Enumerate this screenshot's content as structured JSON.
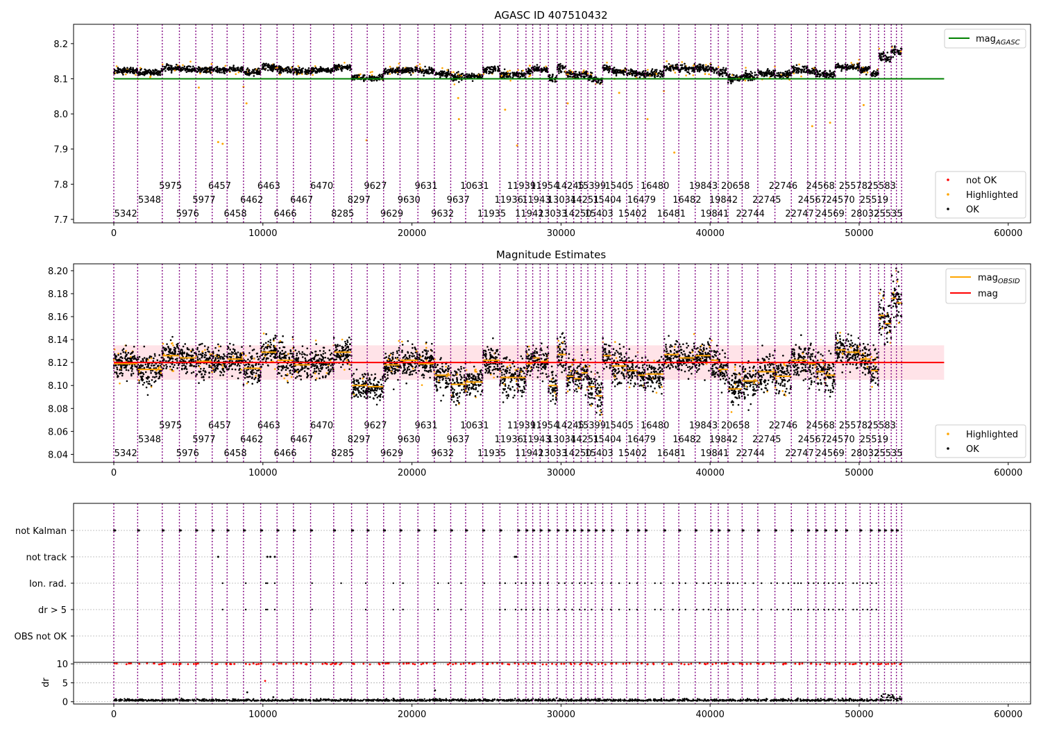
{
  "colors": {
    "ok": "#000000",
    "highlighted": "#ffa500",
    "not_ok": "#ff0000",
    "mag_agasc_line": "#008000",
    "mag_line": "#ff0000",
    "mag_band": "#ffc0cb",
    "obs_line": "#800080"
  },
  "obs_boundaries": [
    0,
    1600,
    3250,
    4400,
    5500,
    6600,
    7600,
    8700,
    9850,
    10950,
    12050,
    13200,
    14750,
    15950,
    17000,
    18100,
    19200,
    20400,
    21500,
    22600,
    23600,
    24750,
    25900,
    27100,
    27650,
    28100,
    28600,
    29150,
    29750,
    30350,
    30850,
    31350,
    31800,
    32300,
    32800,
    33400,
    34400,
    35150,
    35650,
    36900,
    37900,
    39000,
    40050,
    40550,
    41200,
    42150,
    43200,
    44350,
    45450,
    46550,
    47100,
    47700,
    48400,
    49100,
    50050,
    50750,
    51300,
    51700,
    52150,
    52500,
    52850
  ],
  "obs_labels": [
    {
      "x": 800,
      "row": 0,
      "text": "5342"
    },
    {
      "x": 2400,
      "row": 1,
      "text": "5348"
    },
    {
      "x": 3800,
      "row": 2,
      "text": "5975"
    },
    {
      "x": 4950,
      "row": 0,
      "text": "5976"
    },
    {
      "x": 6050,
      "row": 1,
      "text": "5977"
    },
    {
      "x": 7100,
      "row": 2,
      "text": "6457"
    },
    {
      "x": 8150,
      "row": 0,
      "text": "6458"
    },
    {
      "x": 9250,
      "row": 1,
      "text": "6462"
    },
    {
      "x": 10400,
      "row": 2,
      "text": "6463"
    },
    {
      "x": 11500,
      "row": 0,
      "text": "6466"
    },
    {
      "x": 12600,
      "row": 1,
      "text": "6467"
    },
    {
      "x": 13950,
      "row": 2,
      "text": "6470"
    },
    {
      "x": 15350,
      "row": 0,
      "text": "8285"
    },
    {
      "x": 16450,
      "row": 1,
      "text": "8297"
    },
    {
      "x": 17550,
      "row": 2,
      "text": "9627"
    },
    {
      "x": 18650,
      "row": 0,
      "text": "9629"
    },
    {
      "x": 19800,
      "row": 1,
      "text": "9630"
    },
    {
      "x": 20950,
      "row": 2,
      "text": "9631"
    },
    {
      "x": 22050,
      "row": 0,
      "text": "9632"
    },
    {
      "x": 23100,
      "row": 1,
      "text": "9637"
    },
    {
      "x": 24200,
      "row": 2,
      "text": "10631"
    },
    {
      "x": 25350,
      "row": 0,
      "text": "11935"
    },
    {
      "x": 26500,
      "row": 1,
      "text": "11936"
    },
    {
      "x": 27350,
      "row": 2,
      "text": "11939"
    },
    {
      "x": 27880,
      "row": 0,
      "text": "11942"
    },
    {
      "x": 28350,
      "row": 1,
      "text": "11943"
    },
    {
      "x": 28900,
      "row": 2,
      "text": "11954"
    },
    {
      "x": 29450,
      "row": 0,
      "text": "13033"
    },
    {
      "x": 30050,
      "row": 1,
      "text": "13034"
    },
    {
      "x": 30600,
      "row": 2,
      "text": "14245"
    },
    {
      "x": 31100,
      "row": 0,
      "text": "14250"
    },
    {
      "x": 31600,
      "row": 1,
      "text": "14251"
    },
    {
      "x": 32050,
      "row": 2,
      "text": "15399"
    },
    {
      "x": 32550,
      "row": 0,
      "text": "15403"
    },
    {
      "x": 33100,
      "row": 1,
      "text": "15404"
    },
    {
      "x": 33900,
      "row": 2,
      "text": "15405"
    },
    {
      "x": 34800,
      "row": 0,
      "text": "15402"
    },
    {
      "x": 35400,
      "row": 1,
      "text": "16479"
    },
    {
      "x": 36300,
      "row": 2,
      "text": "16480"
    },
    {
      "x": 37400,
      "row": 0,
      "text": "16481"
    },
    {
      "x": 38450,
      "row": 1,
      "text": "16482"
    },
    {
      "x": 39550,
      "row": 2,
      "text": "19843"
    },
    {
      "x": 40300,
      "row": 0,
      "text": "19841"
    },
    {
      "x": 40900,
      "row": 1,
      "text": "19842"
    },
    {
      "x": 41700,
      "row": 2,
      "text": "20658"
    },
    {
      "x": 42700,
      "row": 0,
      "text": "22744"
    },
    {
      "x": 43800,
      "row": 1,
      "text": "22745"
    },
    {
      "x": 44900,
      "row": 2,
      "text": "22746"
    },
    {
      "x": 46000,
      "row": 0,
      "text": "22747"
    },
    {
      "x": 46850,
      "row": 1,
      "text": "24567"
    },
    {
      "x": 47400,
      "row": 2,
      "text": "24568"
    },
    {
      "x": 48050,
      "row": 0,
      "text": "24569"
    },
    {
      "x": 48750,
      "row": 1,
      "text": "24570"
    },
    {
      "x": 49600,
      "row": 2,
      "text": "25578"
    },
    {
      "x": 50400,
      "row": 0,
      "text": "28032"
    },
    {
      "x": 51000,
      "row": 1,
      "text": "25519"
    },
    {
      "x": 51500,
      "row": 2,
      "text": "25583"
    },
    {
      "x": 51950,
      "row": 0,
      "text": "25535"
    }
  ],
  "chart_data": [
    {
      "type": "scatter",
      "title": "AGASC ID 407510432",
      "xlim": [
        -2700,
        61500
      ],
      "ylim": [
        7.69,
        8.255
      ],
      "xticks": [
        0,
        10000,
        20000,
        30000,
        40000,
        50000,
        60000
      ],
      "yticks": [
        7.7,
        7.8,
        7.9,
        8.0,
        8.1,
        8.2
      ],
      "ytick_labels": [
        "7.7",
        "7.8",
        "7.9",
        "8.0",
        "8.1",
        "8.2"
      ],
      "mag_agasc": 8.1,
      "mag_agasc_xrange": [
        0,
        55700
      ],
      "segment_means": [
        8.123,
        8.118,
        8.13,
        8.128,
        8.125,
        8.124,
        8.127,
        8.119,
        8.133,
        8.126,
        8.122,
        8.124,
        8.133,
        8.104,
        8.103,
        8.122,
        8.126,
        8.123,
        8.113,
        8.105,
        8.107,
        8.126,
        8.111,
        8.111,
        8.123,
        8.128,
        8.125,
        8.104,
        8.131,
        8.112,
        8.11,
        8.115,
        8.103,
        8.095,
        8.13,
        8.121,
        8.117,
        8.113,
        8.114,
        8.131,
        8.128,
        8.13,
        8.126,
        8.118,
        8.101,
        8.108,
        8.116,
        8.112,
        8.126,
        8.123,
        8.116,
        8.113,
        8.135,
        8.133,
        8.127,
        8.117,
        8.165,
        8.158,
        8.18,
        8.176
      ],
      "segment_spreads": [
        0.006,
        0.007,
        0.006,
        0.006,
        0.007,
        0.006,
        0.006,
        0.007,
        0.007,
        0.007,
        0.006,
        0.006,
        0.006,
        0.006,
        0.006,
        0.007,
        0.007,
        0.007,
        0.007,
        0.008,
        0.006,
        0.007,
        0.008,
        0.007,
        0.007,
        0.006,
        0.007,
        0.008,
        0.008,
        0.007,
        0.007,
        0.007,
        0.008,
        0.009,
        0.006,
        0.007,
        0.007,
        0.007,
        0.007,
        0.007,
        0.007,
        0.007,
        0.008,
        0.007,
        0.008,
        0.008,
        0.008,
        0.008,
        0.008,
        0.008,
        0.008,
        0.008,
        0.007,
        0.007,
        0.007,
        0.008,
        0.01,
        0.01,
        0.009,
        0.009
      ],
      "highlighted_outliers": [
        [
          5700,
          8.075
        ],
        [
          7000,
          7.92
        ],
        [
          7300,
          7.915
        ],
        [
          8700,
          8.077
        ],
        [
          8900,
          8.03
        ],
        [
          16950,
          7.925
        ],
        [
          23100,
          8.045
        ],
        [
          23150,
          7.985
        ],
        [
          26250,
          8.012
        ],
        [
          27050,
          7.91
        ],
        [
          30450,
          8.03
        ],
        [
          33600,
          8.1
        ],
        [
          33900,
          8.06
        ],
        [
          35800,
          7.985
        ],
        [
          36900,
          8.065
        ],
        [
          37600,
          7.89
        ],
        [
          46850,
          7.965
        ],
        [
          48050,
          7.975
        ],
        [
          50300,
          8.025
        ]
      ],
      "legend": {
        "position": "top-right",
        "entries": [
          "mag_AGASC"
        ]
      },
      "legend2": {
        "position": "bottom-right",
        "entries": [
          "not OK",
          "Highlighted",
          "OK"
        ]
      }
    },
    {
      "type": "scatter",
      "title": "Magnitude Estimates",
      "xlim": [
        -2700,
        61500
      ],
      "ylim": [
        8.033,
        8.206
      ],
      "xticks": [
        0,
        10000,
        20000,
        30000,
        40000,
        50000,
        60000
      ],
      "yticks": [
        8.04,
        8.06,
        8.08,
        8.1,
        8.12,
        8.14,
        8.16,
        8.18,
        8.2
      ],
      "ytick_labels": [
        "8.04",
        "8.06",
        "8.08",
        "8.10",
        "8.12",
        "8.14",
        "8.16",
        "8.18",
        "8.20"
      ],
      "mag": 8.12,
      "mag_band": [
        8.105,
        8.135
      ],
      "mag_xrange": [
        0,
        55700
      ],
      "legend": {
        "position": "top-right",
        "entries": [
          "mag_OBSID",
          "mag"
        ]
      },
      "legend2": {
        "position": "bottom-right",
        "entries": [
          "Highlighted",
          "OK"
        ]
      }
    },
    {
      "type": "scatter",
      "title": "",
      "xlim": [
        -2700,
        61500
      ],
      "categories": [
        "not Kalman",
        "not track",
        "Ion. rad.",
        "dr > 5",
        "OBS not OK"
      ],
      "flags": {
        "not Kalman": "all",
        "not track": [
          [
            7000
          ],
          [
            10300,
            10500,
            10800
          ],
          [
            26900,
            27000
          ]
        ],
        "Ion. rad.": [
          7300,
          8850,
          10200,
          10300,
          10800,
          13300,
          15250,
          16900,
          18750,
          19400,
          21750,
          22450,
          23300,
          24850,
          25900,
          26250,
          26950,
          27350,
          27650,
          28150,
          28600,
          29100,
          29850,
          30250,
          30750,
          31250,
          31600,
          32050,
          32750,
          33350,
          33900,
          34600,
          35100,
          36300,
          36700,
          37500,
          37950,
          38350,
          39100,
          39550,
          39900,
          40350,
          40750,
          41150,
          41300,
          41550,
          41850,
          42350,
          42900,
          43450,
          44100,
          44500,
          44900,
          45250,
          45650,
          45900,
          46100,
          46600,
          46950,
          47250,
          47650,
          47950,
          48250,
          48650,
          48900,
          49600,
          49850,
          50250,
          50550,
          50850,
          51150
        ],
        "dr > 5": [
          7300,
          8850,
          10200,
          10300,
          10800,
          13300,
          16900,
          18750,
          19400,
          21750,
          23300,
          25900,
          26250,
          26950,
          27350,
          27650,
          28150,
          28600,
          29100,
          29850,
          30250,
          30750,
          31250,
          31600,
          32050,
          32750,
          33350,
          33900,
          34600,
          35100,
          36300,
          36700,
          37500,
          37950,
          38350,
          39100,
          39550,
          39900,
          40350,
          40750,
          41150,
          41300,
          41550,
          41850,
          42350,
          42900,
          43450,
          44100,
          44500,
          44900,
          45250,
          45650,
          45900,
          46100,
          46600,
          46950,
          47250,
          47650,
          47950,
          48250,
          48650,
          48900,
          49600,
          49850,
          50250,
          50550,
          50850,
          51150
        ]
      }
    },
    {
      "type": "scatter",
      "title": "",
      "ylabel": "dr",
      "xlim": [
        -2700,
        61500
      ],
      "ylim": [
        -0.6,
        10.4
      ],
      "yticks": [
        0,
        5,
        10
      ],
      "ytick_labels": [
        "0",
        "5",
        "10"
      ],
      "xticks": [
        0,
        10000,
        20000,
        30000,
        40000,
        50000,
        60000
      ],
      "red_at": 10,
      "outliers": [
        [
          8950,
          2.5
        ],
        [
          10150,
          5.5
        ],
        [
          10700,
          1.2
        ],
        [
          21550,
          3.0
        ]
      ]
    }
  ]
}
